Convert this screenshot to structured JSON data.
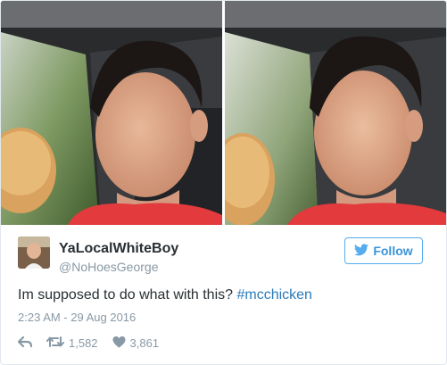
{
  "tweet": {
    "display_name": "YaLocalWhiteBoy",
    "handle": "@NoHoesGeorge",
    "text": "Im supposed to do what with this? ",
    "hashtag": "#mcchicken",
    "timestamp": "2:23 AM - 29 Aug 2016"
  },
  "follow_button": {
    "label": "Follow",
    "icon": "twitter-bird-icon"
  },
  "actions": {
    "reply_icon": "reply-icon",
    "retweet_icon": "retweet-icon",
    "retweet_count": "1,582",
    "like_icon": "heart-icon",
    "like_count": "3,861"
  },
  "colors": {
    "accent": "#55acee",
    "hashtag": "#2b7bb9",
    "muted": "#8899a6",
    "text": "#292f33"
  }
}
